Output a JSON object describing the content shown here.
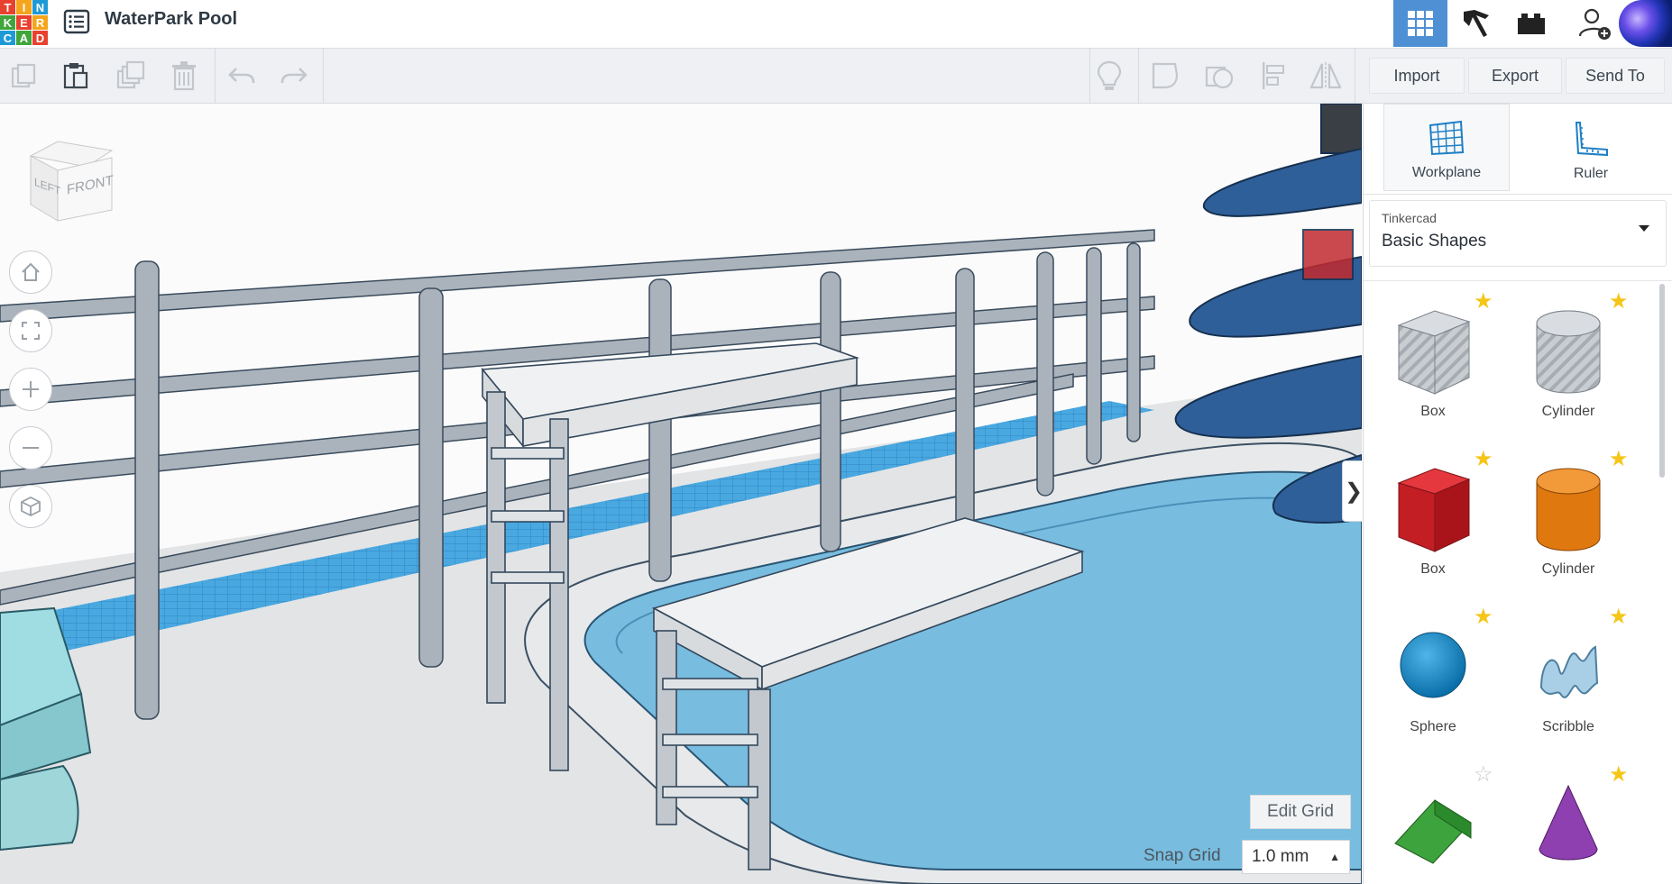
{
  "app": {
    "logo_letters": [
      "T",
      "I",
      "N",
      "K",
      "E",
      "R",
      "C",
      "A",
      "D"
    ],
    "logo_colors": [
      "#e8412e",
      "#f4a51c",
      "#1d9ad6",
      "#40a63b",
      "#e8412e",
      "#f4a51c",
      "#1d9ad6",
      "#40a63b",
      "#e8412e"
    ]
  },
  "header": {
    "design_title": "WaterPark Pool"
  },
  "toolbar": {
    "left_tools": [
      "copy-icon",
      "paste-icon",
      "duplicate-icon",
      "delete-icon",
      "undo-icon",
      "redo-icon"
    ],
    "right_tools": [
      "notes-icon",
      "shape-hole-icon",
      "group-icon",
      "align-icon",
      "mirror-icon"
    ],
    "import_label": "Import",
    "export_label": "Export",
    "sendto_label": "Send To"
  },
  "viewcube": {
    "left_label": "LEFT",
    "front_label": "FRONT"
  },
  "workspace": {
    "edit_grid_label": "Edit Grid",
    "snap_grid_label": "Snap Grid",
    "snap_grid_value": "1.0 mm",
    "collapse_label": "❯"
  },
  "panel": {
    "workplane_label": "Workplane",
    "ruler_label": "Ruler",
    "library_caption": "Tinkercad",
    "library_value": "Basic Shapes",
    "shapes": [
      {
        "label": "Box",
        "icon": "box-hole-icon",
        "starred": true
      },
      {
        "label": "Cylinder",
        "icon": "cylinder-hole-icon",
        "starred": true
      },
      {
        "label": "Box",
        "icon": "box-red-icon",
        "starred": true
      },
      {
        "label": "Cylinder",
        "icon": "cylinder-orange-icon",
        "starred": true
      },
      {
        "label": "Sphere",
        "icon": "sphere-icon",
        "starred": true
      },
      {
        "label": "Scribble",
        "icon": "scribble-icon",
        "starred": true
      },
      {
        "label": "",
        "icon": "roof-icon",
        "starred": false
      },
      {
        "label": "",
        "icon": "cone-icon",
        "starred": true
      }
    ]
  },
  "colors": {
    "accent_blue": "#4f8fd3",
    "pool_water": "#78bde0",
    "star_gold": "#f5c518"
  }
}
